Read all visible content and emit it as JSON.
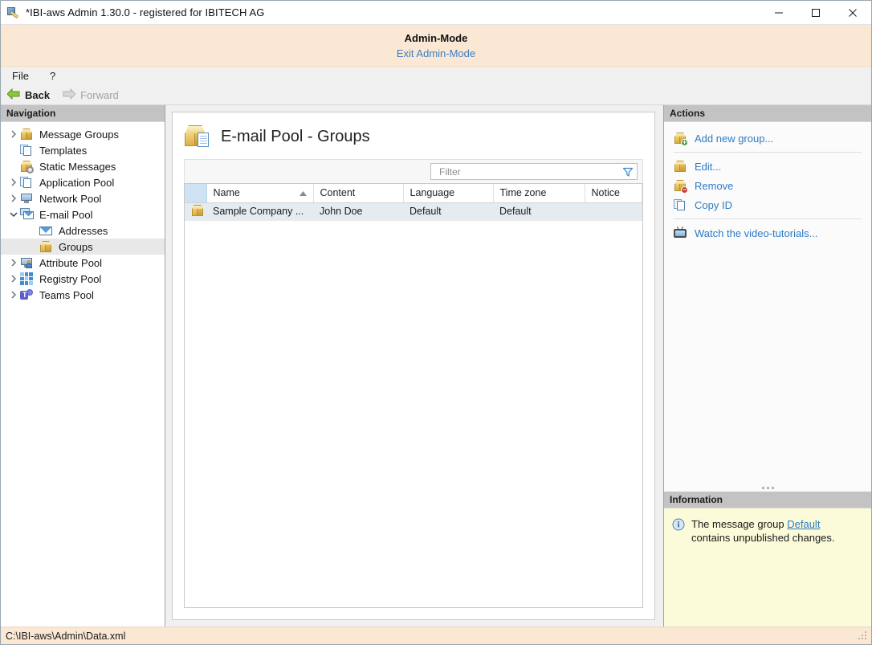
{
  "window": {
    "title": "*IBI-aws Admin 1.30.0 - registered for IBITECH AG",
    "app_icon": "pen-tool-icon",
    "minimize_label": "Minimize",
    "maximize_label": "Maximize",
    "close_label": "Close"
  },
  "admin_banner": {
    "title": "Admin-Mode",
    "exit_link": "Exit Admin-Mode"
  },
  "menubar": {
    "items": [
      {
        "label": "File",
        "name": "menu-file"
      },
      {
        "label": "?",
        "name": "menu-help"
      }
    ]
  },
  "navbar": {
    "back": "Back",
    "forward": "Forward"
  },
  "navigation": {
    "header": "Navigation",
    "items": [
      {
        "label": "Message Groups",
        "icon": "gold-box-icon",
        "expander": "collapsed",
        "indent": 0,
        "selected": false
      },
      {
        "label": "Templates",
        "icon": "pages-icon",
        "expander": "none",
        "indent": 0,
        "selected": false
      },
      {
        "label": "Static Messages",
        "icon": "gold-box-gear-icon",
        "expander": "none",
        "indent": 0,
        "selected": false
      },
      {
        "label": "Application Pool",
        "icon": "pages-icon",
        "expander": "collapsed",
        "indent": 0,
        "selected": false
      },
      {
        "label": "Network Pool",
        "icon": "monitor-icon",
        "expander": "collapsed",
        "indent": 0,
        "selected": false
      },
      {
        "label": "E-mail Pool",
        "icon": "mail-stack-icon",
        "expander": "expanded",
        "indent": 0,
        "selected": false
      },
      {
        "label": "Addresses",
        "icon": "envelope-icon",
        "expander": "none",
        "indent": 1,
        "selected": false
      },
      {
        "label": "Groups",
        "icon": "gold-box-icon",
        "expander": "none",
        "indent": 1,
        "selected": true
      },
      {
        "label": "Attribute Pool",
        "icon": "monitor-person-icon",
        "expander": "collapsed",
        "indent": 0,
        "selected": false
      },
      {
        "label": "Registry Pool",
        "icon": "grid-icon",
        "expander": "collapsed",
        "indent": 0,
        "selected": false
      },
      {
        "label": "Teams Pool",
        "icon": "teams-icon",
        "expander": "collapsed",
        "indent": 0,
        "selected": false
      }
    ]
  },
  "content": {
    "title": "E-mail Pool - Groups",
    "title_icon": "gold-box-document-icon",
    "filter": {
      "value": "",
      "placeholder": "Filter",
      "icon": "funnel-icon"
    },
    "table": {
      "columns": [
        "Name",
        "Content",
        "Language",
        "Time zone",
        "Notice"
      ],
      "sort_column": "Name",
      "sort_direction": "ascending",
      "rows": [
        {
          "icon": "gold-box-icon",
          "Name": "Sample Company ...",
          "Content": "John Doe",
          "Language": "Default",
          "Time zone": "Default",
          "Notice": ""
        }
      ]
    }
  },
  "actions": {
    "header": "Actions",
    "items": [
      {
        "label": "Add new group...",
        "icon": "gold-box-plus-icon",
        "separator_after": true
      },
      {
        "label": "Edit...",
        "icon": "gold-box-icon",
        "separator_after": false
      },
      {
        "label": "Remove",
        "icon": "gold-box-minus-icon",
        "separator_after": false
      },
      {
        "label": "Copy ID",
        "icon": "copy-pages-icon",
        "separator_after": true
      },
      {
        "label": "Watch the video-tutorials...",
        "icon": "tv-icon",
        "separator_after": false
      }
    ]
  },
  "information": {
    "header": "Information",
    "icon": "info-icon",
    "text_before": "The message group ",
    "link": "Default",
    "text_after": " contains unpublished changes."
  },
  "statusbar": {
    "path": "C:\\IBI-aws\\Admin\\Data.xml"
  },
  "colors": {
    "accent_link": "#2e7bc4",
    "admin_banner_bg": "#fae8d4",
    "panel_header_bg": "#c3c3c3",
    "info_bg": "#fbfbda",
    "selected_row_bg": "#e4ecf2"
  }
}
